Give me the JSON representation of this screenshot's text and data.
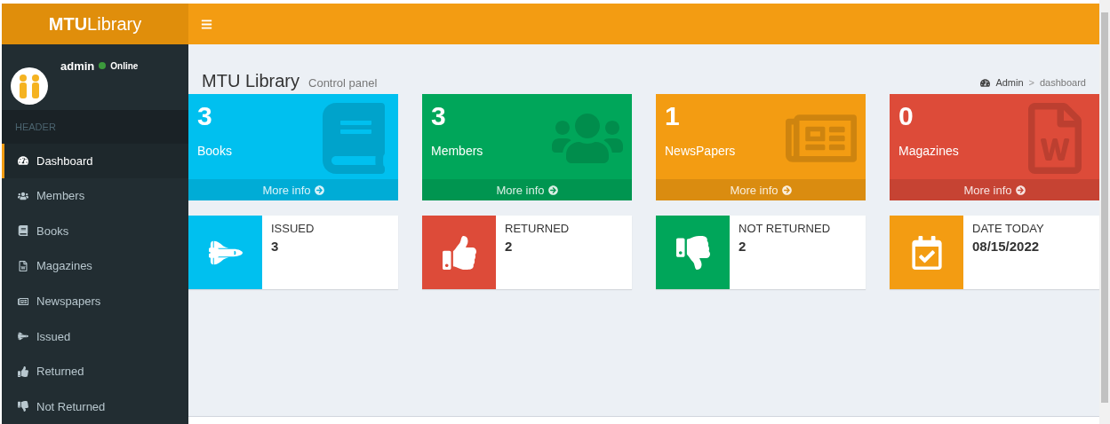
{
  "header": {
    "brand": "**MTU**Library"
  },
  "user": {
    "name": "admin",
    "status": "Online"
  },
  "sidebar": {
    "heading": "HEADER",
    "items": [
      {
        "label": "Dashboard",
        "kind": "dashboard",
        "selected": true
      },
      {
        "label": "Members",
        "kind": "users",
        "selected": false
      },
      {
        "label": "Books",
        "kind": "book",
        "selected": false
      },
      {
        "label": "Magazines",
        "kind": "word",
        "selected": false
      },
      {
        "label": "Newspapers",
        "kind": "newspaper",
        "selected": false
      },
      {
        "label": "Issued",
        "kind": "shuttle",
        "selected": false
      },
      {
        "label": "Returned",
        "kind": "up",
        "selected": false
      },
      {
        "label": "Not Returned",
        "kind": "down",
        "selected": false
      }
    ]
  },
  "content": {
    "title": "MTU Library",
    "subtitle": "Control panel",
    "breadcrumb": [
      "Admin",
      "dashboard"
    ],
    "breadcrumb_separator": ">"
  },
  "stat_boxes": [
    {
      "value": "3",
      "label": "Books",
      "link": "More info",
      "color": "#00c0ef",
      "kind": "book"
    },
    {
      "value": "3",
      "label": "Members",
      "link": "More info",
      "color": "#00a65a",
      "kind": "users"
    },
    {
      "value": "1",
      "label": "NewsPapers",
      "link": "More info",
      "color": "#f39c12",
      "kind": "newspaper"
    },
    {
      "value": "0",
      "label": "Magazines",
      "link": "More info",
      "color": "#dd4b39",
      "kind": "word"
    }
  ],
  "info_boxes": [
    {
      "label": "ISSUED",
      "value": "3",
      "color": "#00c0ef",
      "kind": "shuttle"
    },
    {
      "label": "RETURNED",
      "value": "2",
      "color": "#dd4b39",
      "kind": "up"
    },
    {
      "label": "NOT RETURNED",
      "value": "2",
      "color": "#00a65a",
      "kind": "down"
    },
    {
      "label": "DATE TODAY",
      "value": "08/15/2022",
      "color": "#f39c12",
      "kind": "calendar"
    }
  ]
}
